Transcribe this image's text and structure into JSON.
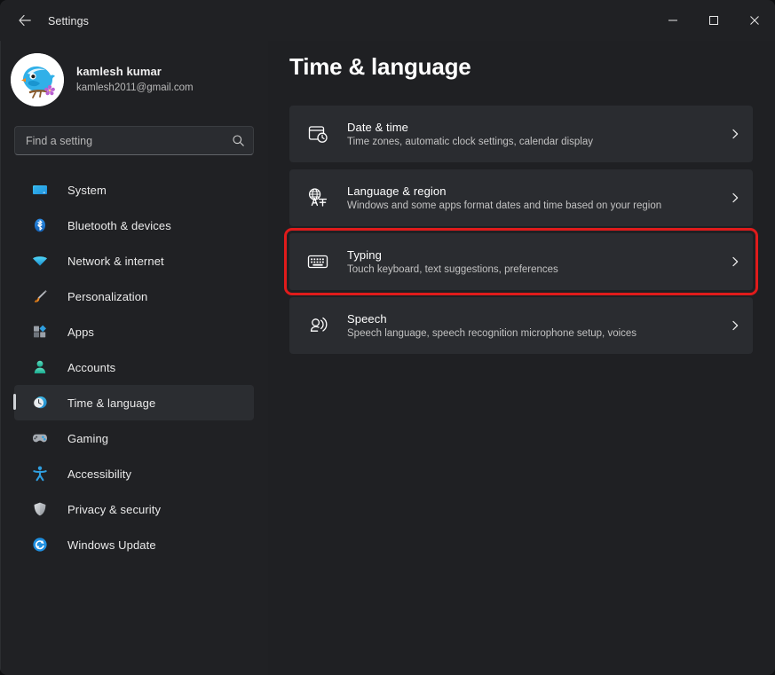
{
  "window": {
    "app_title": "Settings",
    "back_icon": "back-arrow-icon",
    "minimize_label": "Minimize",
    "maximize_label": "Maximize",
    "close_label": "Close",
    "accent_color": "#cfd2d6",
    "highlight_color": "#e01b1b",
    "background": "#1f2023",
    "sidebar_background": "#202124",
    "card_background": "#2a2c30"
  },
  "profile": {
    "name": "kamlesh kumar",
    "email": "kamlesh2011@gmail.com",
    "avatar_icon": "bird-avatar"
  },
  "search": {
    "placeholder": "Find a setting",
    "value": "",
    "icon": "search-icon"
  },
  "sidebar": {
    "items": [
      {
        "label": "System",
        "icon": "system-icon",
        "selected": false
      },
      {
        "label": "Bluetooth & devices",
        "icon": "bluetooth-icon",
        "selected": false
      },
      {
        "label": "Network & internet",
        "icon": "network-icon",
        "selected": false
      },
      {
        "label": "Personalization",
        "icon": "personalization-icon",
        "selected": false
      },
      {
        "label": "Apps",
        "icon": "apps-icon",
        "selected": false
      },
      {
        "label": "Accounts",
        "icon": "accounts-icon",
        "selected": false
      },
      {
        "label": "Time & language",
        "icon": "time-language-icon",
        "selected": true
      },
      {
        "label": "Gaming",
        "icon": "gaming-icon",
        "selected": false
      },
      {
        "label": "Accessibility",
        "icon": "accessibility-icon",
        "selected": false
      },
      {
        "label": "Privacy & security",
        "icon": "privacy-security-icon",
        "selected": false
      },
      {
        "label": "Windows Update",
        "icon": "windows-update-icon",
        "selected": false
      }
    ]
  },
  "main": {
    "page_title": "Time & language",
    "cards": [
      {
        "title": "Date & time",
        "subtitle": "Time zones, automatic clock settings, calendar display",
        "icon": "calendar-clock-icon",
        "chevron": "chevron-right-icon",
        "highlighted": false
      },
      {
        "title": "Language & region",
        "subtitle": "Windows and some apps format dates and time based on your region",
        "icon": "language-translate-icon",
        "chevron": "chevron-right-icon",
        "highlighted": false
      },
      {
        "title": "Typing",
        "subtitle": "Touch keyboard, text suggestions, preferences",
        "icon": "keyboard-icon",
        "chevron": "chevron-right-icon",
        "highlighted": true
      },
      {
        "title": "Speech",
        "subtitle": "Speech language, speech recognition microphone setup, voices",
        "icon": "speech-icon",
        "chevron": "chevron-right-icon",
        "highlighted": false
      }
    ]
  }
}
